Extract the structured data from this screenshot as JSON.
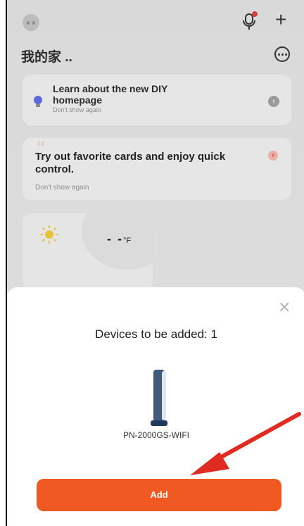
{
  "home": {
    "title": "我的家 ..",
    "icons": {
      "avatar": "robot-avatar-icon",
      "mic": "microphone-icon",
      "add": "plus-icon",
      "more": "more-options-icon"
    }
  },
  "cards": [
    {
      "title": "Learn about the new DIY homepage",
      "dismiss": "Don't show again",
      "icon": "lightbulb-icon"
    },
    {
      "title": "Try out favorite cards and enjoy quick control.",
      "dismiss": "Don't show again",
      "icon": "quote-icon"
    }
  ],
  "weather": {
    "temperature": "- -",
    "unit": "°F",
    "icon": "sun-icon"
  },
  "sheet": {
    "title": "Devices to be added: 1",
    "device_name": "PN-2000GS-WIFI",
    "add_label": "Add",
    "close_icon": "close-icon",
    "accent_color": "#f05a22"
  }
}
